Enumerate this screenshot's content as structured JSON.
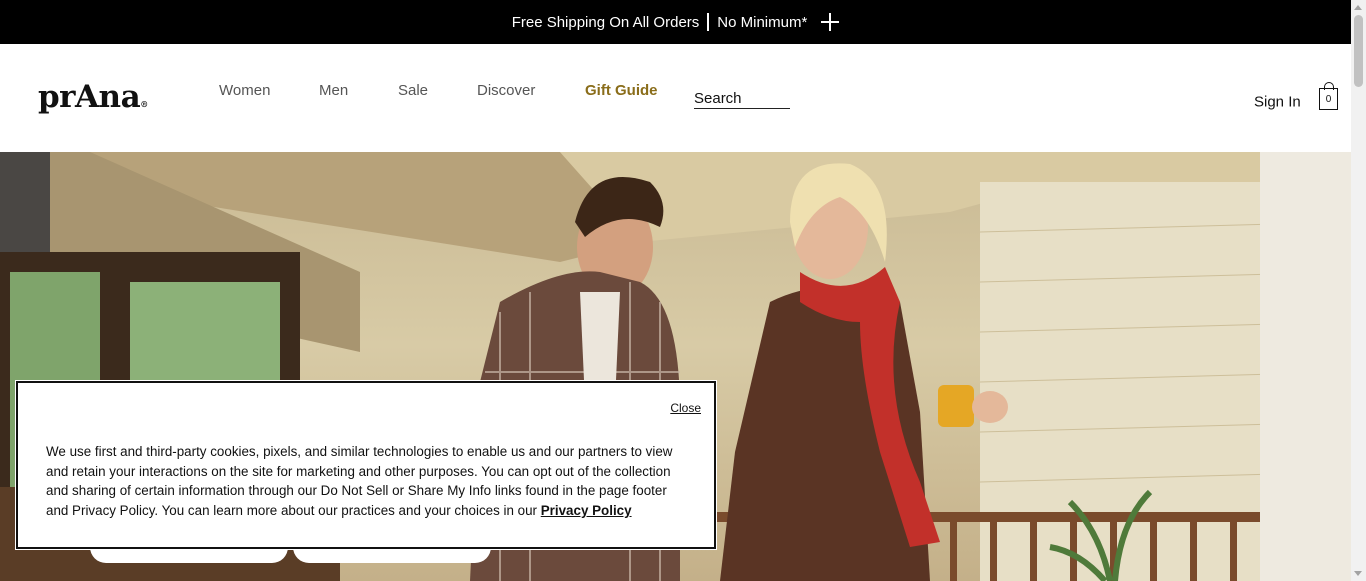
{
  "promo": {
    "text_left": "Free Shipping On All Orders",
    "text_right": "No Minimum*"
  },
  "header": {
    "logo": "prAna",
    "nav": [
      "Women",
      "Men",
      "Sale",
      "Discover",
      "Gift Guide"
    ],
    "search_label": "Search",
    "sign_in": "Sign In",
    "cart_count": "0"
  },
  "cookie_banner": {
    "close_label": "Close",
    "body": "We use first and third-party cookies, pixels, and similar technologies to enable us and our partners to view and retain your interactions on the site for marketing and other purposes. You can opt out of the collection and sharing of certain information through our Do Not Sell or Share My Info links found in the page footer and Privacy Policy. You can learn more about our practices and your choices in our ",
    "link_label": "Privacy Policy"
  }
}
